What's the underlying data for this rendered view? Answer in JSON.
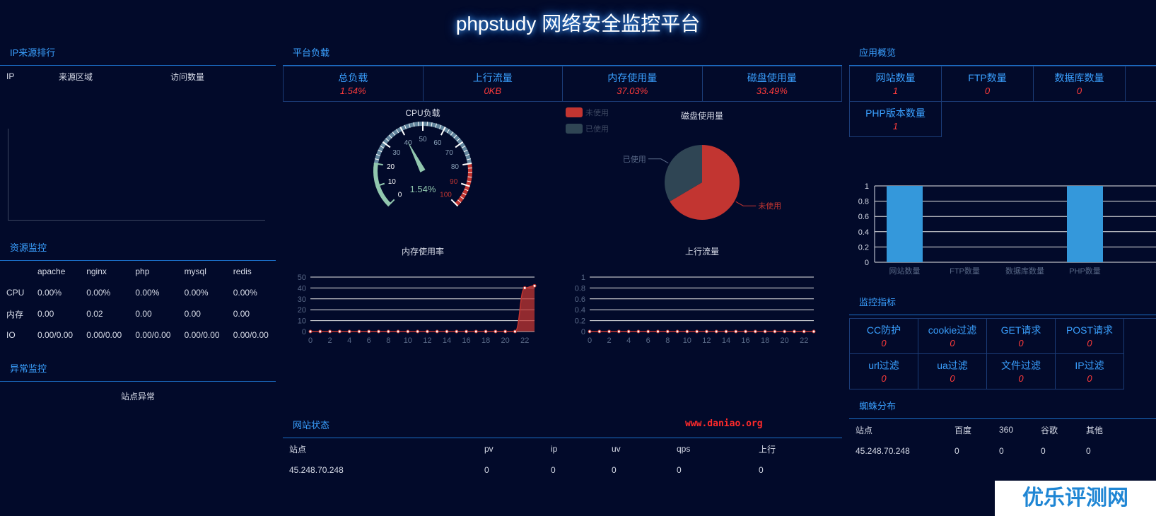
{
  "page_title": "phpstudy 网络安全监控平台",
  "ip_rank": {
    "heading": "IP来源排行",
    "columns": [
      "IP",
      "来源区域",
      "访问数量"
    ]
  },
  "resource": {
    "heading": "资源监控",
    "columns": [
      "",
      "apache",
      "nginx",
      "php",
      "mysql",
      "redis"
    ],
    "rows": [
      [
        "CPU",
        "0.00%",
        "0.00%",
        "0.00%",
        "0.00%",
        "0.00%"
      ],
      [
        "内存",
        "0.00",
        "0.02",
        "0.00",
        "0.00",
        "0.00"
      ],
      [
        "IO",
        "0.00/0.00",
        "0.00/0.00",
        "0.00/0.00",
        "0.00/0.00",
        "0.00/0.00"
      ]
    ]
  },
  "anomaly": {
    "heading": "异常监控",
    "label": "站点异常"
  },
  "platform": {
    "heading": "平台负载",
    "stats": [
      {
        "label": "总负载",
        "value": "1.54%"
      },
      {
        "label": "上行流量",
        "value": "0KB"
      },
      {
        "label": "内存使用量",
        "value": "37.03%"
      },
      {
        "label": "磁盘使用量",
        "value": "33.49%"
      }
    ]
  },
  "gauge": {
    "title": "CPU负载",
    "value": 1.54,
    "value_text": "1.54%",
    "ticks": [
      "0",
      "10",
      "20",
      "30",
      "40",
      "50",
      "60",
      "70",
      "80",
      "90",
      "100"
    ]
  },
  "disk_pie": {
    "title": "磁盘使用量",
    "legend": [
      {
        "name": "未使用",
        "color": "#c23531"
      },
      {
        "name": "已使用",
        "color": "#2f4554"
      }
    ],
    "slices": [
      {
        "name": "未使用",
        "value": 66.51,
        "color": "#c23531"
      },
      {
        "name": "已使用",
        "value": 33.49,
        "color": "#2f4554"
      }
    ]
  },
  "mem_chart": {
    "title": "内存使用率"
  },
  "up_chart": {
    "title": "上行流量"
  },
  "site_status": {
    "heading": "网站状态",
    "url": "www.daniao.org",
    "columns": [
      "站点",
      "pv",
      "ip",
      "uv",
      "qps",
      "上行"
    ],
    "rows": [
      [
        "45.248.70.248",
        "0",
        "0",
        "0",
        "0",
        "0"
      ]
    ]
  },
  "app_overview": {
    "heading": "应用概览",
    "stats": [
      {
        "label": "网站数量",
        "value": "1"
      },
      {
        "label": "FTP数量",
        "value": "0"
      },
      {
        "label": "数据库数量",
        "value": "0"
      },
      {
        "label": "PHP版本数量",
        "value": "1"
      }
    ]
  },
  "monitor": {
    "heading": "监控指标",
    "items": [
      {
        "label": "CC防护",
        "value": "0"
      },
      {
        "label": "cookie过滤",
        "value": "0"
      },
      {
        "label": "GET请求",
        "value": "0"
      },
      {
        "label": "POST请求",
        "value": "0"
      },
      {
        "label": "url过滤",
        "value": "0"
      },
      {
        "label": "ua过滤",
        "value": "0"
      },
      {
        "label": "文件过滤",
        "value": "0"
      },
      {
        "label": "IP过滤",
        "value": "0"
      }
    ]
  },
  "spider": {
    "heading": "蜘蛛分布",
    "columns": [
      "站点",
      "百度",
      "360",
      "谷歌",
      "其他"
    ],
    "rows": [
      [
        "45.248.70.248",
        "0",
        "0",
        "0",
        "0"
      ]
    ]
  },
  "watermark": "优乐评测网",
  "colors": {
    "accent": "#3aa0ff",
    "alert": "#ff3b3b",
    "bar": "#3498db",
    "area": "#c23531"
  },
  "chart_data": [
    {
      "type": "line",
      "title": "内存使用率",
      "x": [
        0,
        1,
        2,
        3,
        4,
        5,
        6,
        7,
        8,
        9,
        10,
        11,
        12,
        13,
        14,
        15,
        16,
        17,
        18,
        19,
        20,
        21,
        22,
        23
      ],
      "xticks": [
        "0",
        "2",
        "4",
        "6",
        "8",
        "10",
        "12",
        "14",
        "16",
        "18",
        "20",
        "22"
      ],
      "yticks": [
        "0",
        "10",
        "20",
        "30",
        "40",
        "50"
      ],
      "series": [
        {
          "values": [
            0,
            0,
            0,
            0,
            0,
            0,
            0,
            0,
            0,
            0,
            0,
            0,
            0,
            0,
            0,
            0,
            0,
            0,
            0,
            0,
            0,
            0,
            40,
            42
          ]
        }
      ],
      "ylim": [
        0,
        50
      ]
    },
    {
      "type": "line",
      "title": "上行流量",
      "x": [
        0,
        1,
        2,
        3,
        4,
        5,
        6,
        7,
        8,
        9,
        10,
        11,
        12,
        13,
        14,
        15,
        16,
        17,
        18,
        19,
        20,
        21,
        22,
        23
      ],
      "xticks": [
        "0",
        "2",
        "4",
        "6",
        "8",
        "10",
        "12",
        "14",
        "16",
        "18",
        "20",
        "22"
      ],
      "yticks": [
        "0",
        "0.2",
        "0.4",
        "0.6",
        "0.8",
        "1"
      ],
      "series": [
        {
          "values": [
            0,
            0,
            0,
            0,
            0,
            0,
            0,
            0,
            0,
            0,
            0,
            0,
            0,
            0,
            0,
            0,
            0,
            0,
            0,
            0,
            0,
            0,
            0,
            0
          ]
        }
      ],
      "ylim": [
        0,
        1
      ]
    },
    {
      "type": "pie",
      "title": "磁盘使用量",
      "categories": [
        "未使用",
        "已使用"
      ],
      "values": [
        66.51,
        33.49
      ]
    },
    {
      "type": "bar",
      "categories": [
        "网站数量",
        "FTP数量",
        "数据库数量",
        "PHP数量"
      ],
      "values": [
        1,
        0,
        0,
        1
      ],
      "yticks": [
        "0",
        "0.2",
        "0.4",
        "0.6",
        "0.8",
        "1"
      ],
      "ylim": [
        0,
        1
      ]
    }
  ]
}
